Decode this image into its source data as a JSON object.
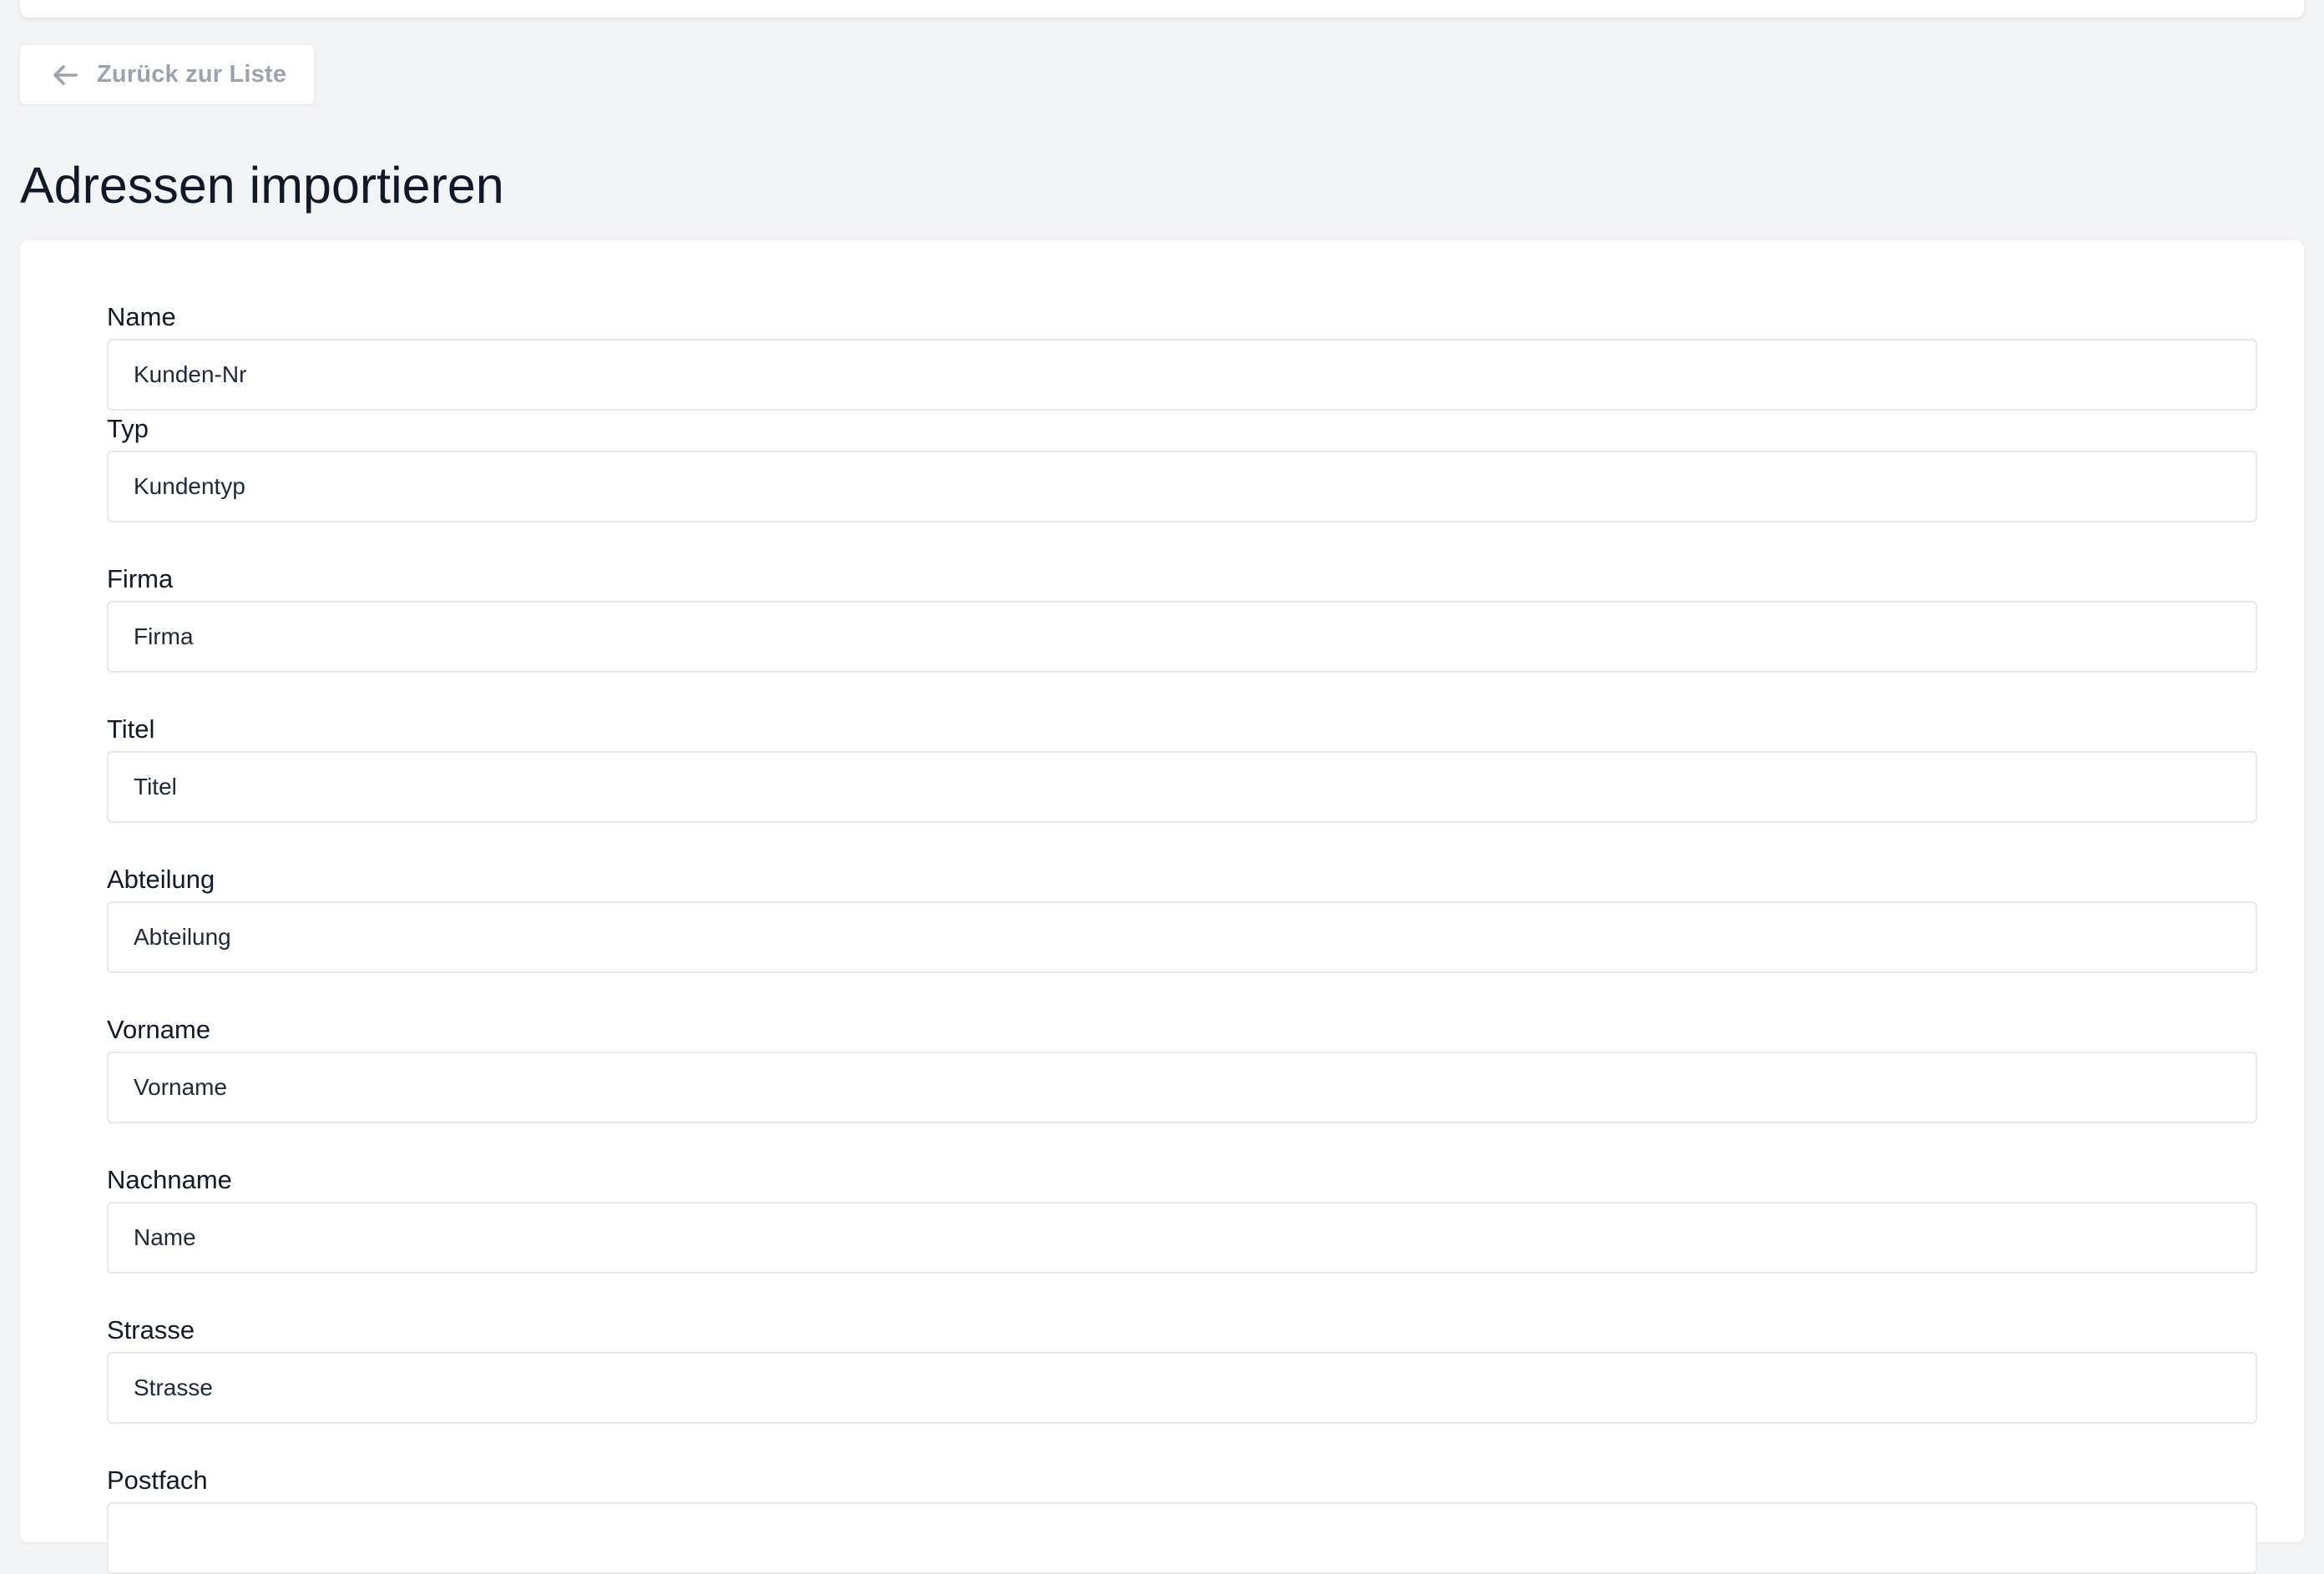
{
  "header": {
    "back_button_label": "Zurück zur Liste",
    "back_icon": "arrow-left-icon",
    "page_title": "Adressen importieren"
  },
  "form": {
    "fields": [
      {
        "label": "Name",
        "value": "Kunden-Nr"
      },
      {
        "label": "Typ",
        "value": "Kundentyp"
      },
      {
        "label": "Firma",
        "value": "Firma"
      },
      {
        "label": "Titel",
        "value": "Titel"
      },
      {
        "label": "Abteilung",
        "value": "Abteilung"
      },
      {
        "label": "Vorname",
        "value": "Vorname"
      },
      {
        "label": "Nachname",
        "value": "Name"
      },
      {
        "label": "Strasse",
        "value": "Strasse"
      },
      {
        "label": "Postfach",
        "value": ""
      }
    ]
  },
  "colors": {
    "background": "#f3f4f6",
    "card": "#ffffff",
    "text": "#111827",
    "muted": "#9ca3af",
    "border": "#e5e7eb"
  }
}
